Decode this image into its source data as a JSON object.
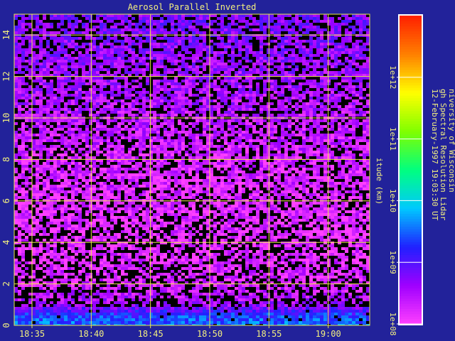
{
  "colors": {
    "background": "#22229a",
    "text": "#f2ef80",
    "grid": "#e8e84a"
  },
  "chart_data": {
    "type": "heatmap",
    "title": "Aerosol Parallel Inverted",
    "xlabel": "",
    "ylabel": "itude (km)",
    "x_ticks": [
      "18:35",
      "18:40",
      "18:45",
      "18:50",
      "18:55",
      "19:00"
    ],
    "x_tick_minutes": [
      1115,
      1120,
      1125,
      1130,
      1135,
      1140
    ],
    "xlim_minutes": [
      1113.5,
      1143.5
    ],
    "y_ticks": [
      "0",
      "2",
      "4",
      "6",
      "8",
      "10",
      "12",
      "14"
    ],
    "y_tick_values": [
      0,
      2,
      4,
      6,
      8,
      10,
      12,
      14
    ],
    "ylim": [
      0,
      15
    ],
    "grid": true,
    "colorbar": {
      "scale": "log",
      "range": [
        100000000.0,
        10000000000000.0
      ],
      "tick_labels": [
        "1e+08",
        "1e+09",
        "1e+10",
        "1e+11",
        "1e+12"
      ],
      "tick_values": [
        100000000.0,
        1000000000.0,
        10000000000.0,
        100000000000.0,
        1000000000000.0
      ],
      "colors": [
        "#ff40ff",
        "#a000ff",
        "#2020ff",
        "#00c8ff",
        "#00ff80",
        "#80ff00",
        "#ffff00",
        "#ff8000",
        "#ff2000"
      ]
    },
    "side_text": [
      "niversity of Wisconsin",
      "gh Spectral Resolution Lidar",
      "12-February-1997 19:03:30 UT"
    ],
    "field_profile": [
      {
        "altitude_km": 0.2,
        "value": 3000000000.0
      },
      {
        "altitude_km": 0.5,
        "value": 2000000000.0
      },
      {
        "altitude_km": 1.0,
        "value": 400000000.0
      },
      {
        "altitude_km": 2.0,
        "value": 200000000.0
      },
      {
        "altitude_km": 4.0,
        "value": 150000000.0
      },
      {
        "altitude_km": 8.0,
        "value": 200000000.0
      },
      {
        "altitude_km": 12.0,
        "value": 400000000.0
      },
      {
        "altitude_km": 14.5,
        "value": 600000000.0
      }
    ]
  }
}
